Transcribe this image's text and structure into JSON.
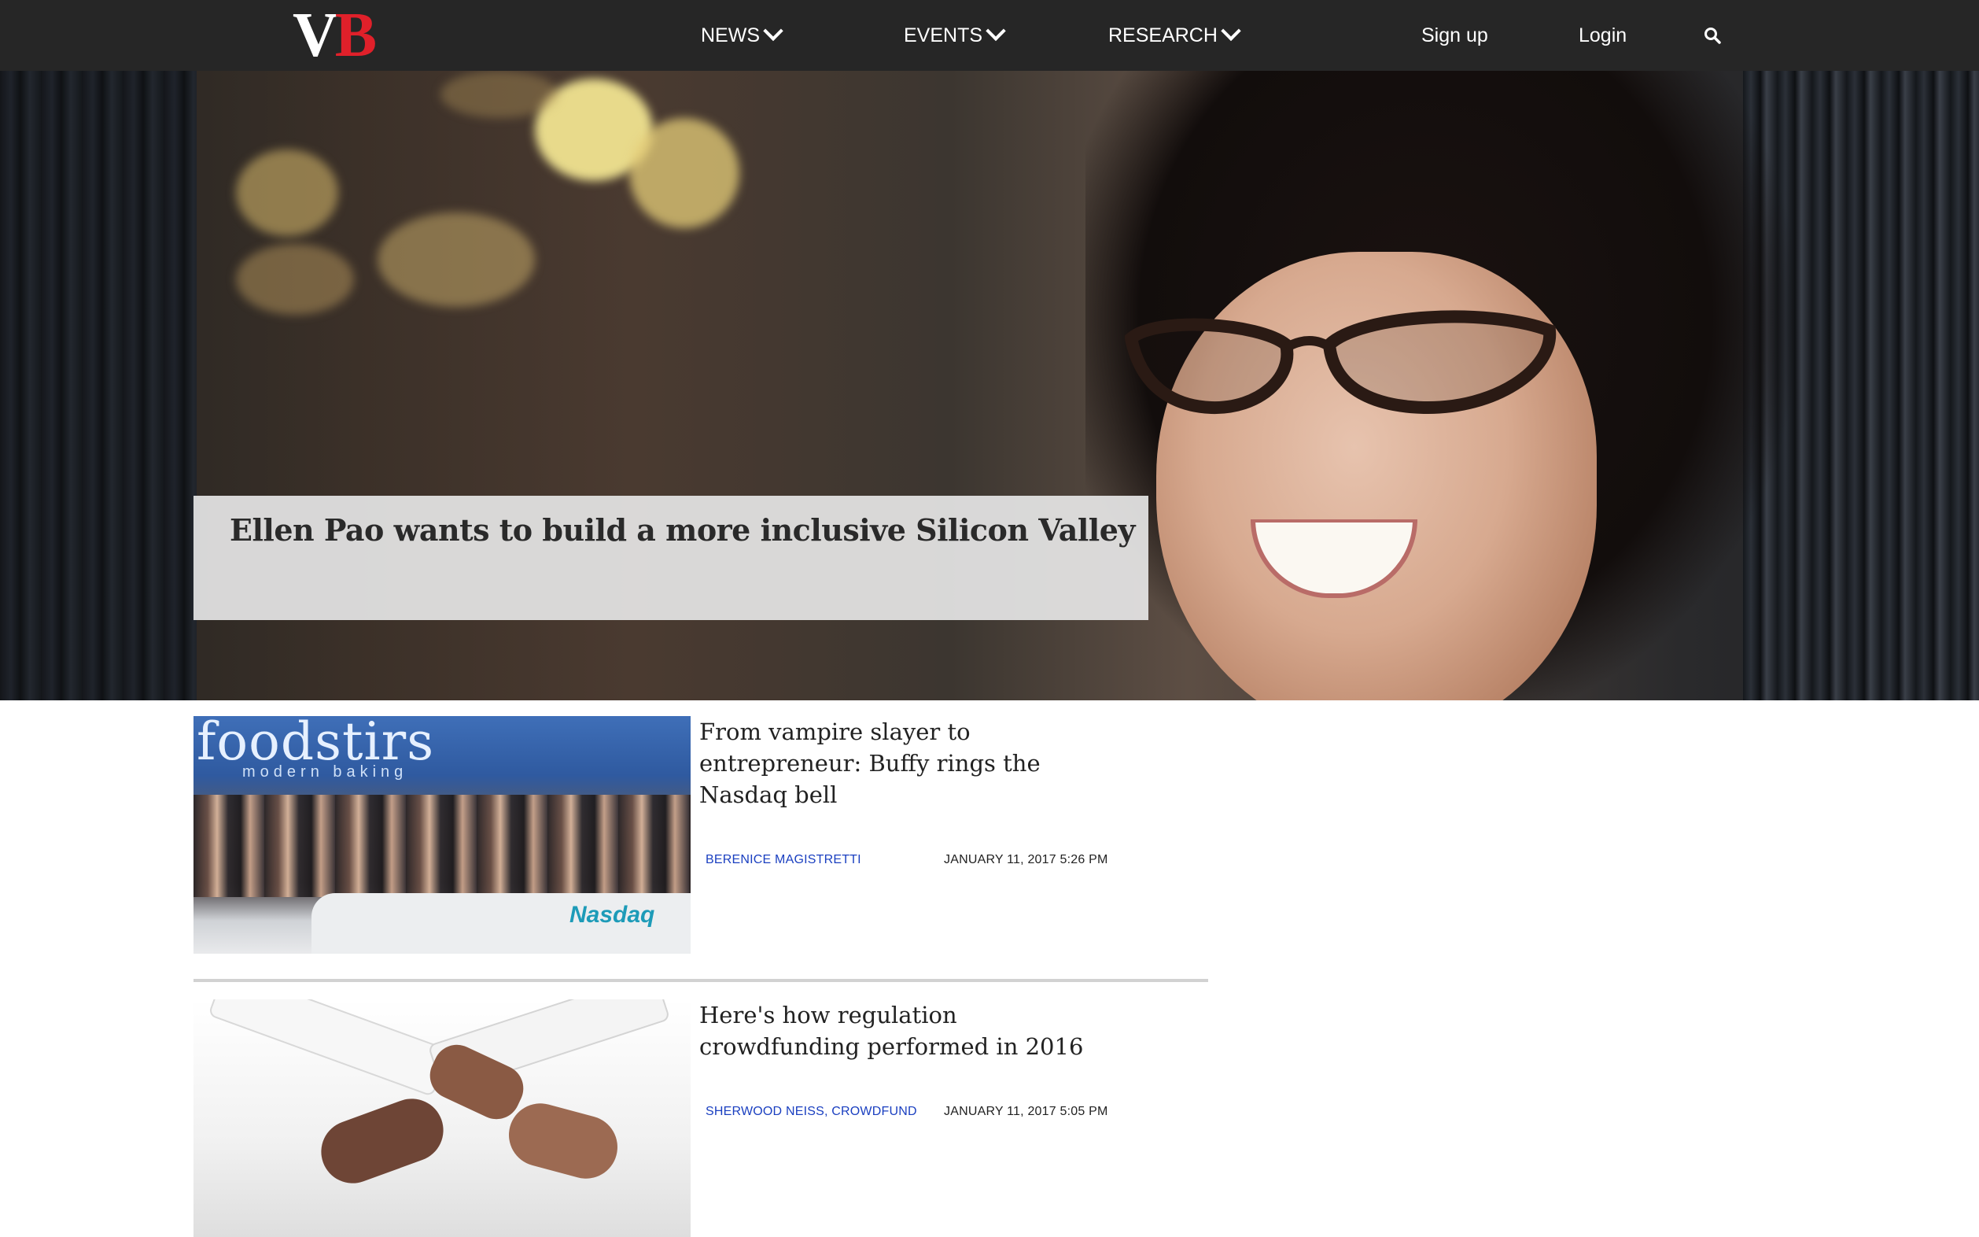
{
  "nav": {
    "logo_v": "V",
    "logo_b": "B",
    "items": [
      {
        "label": "NEWS"
      },
      {
        "label": "EVENTS"
      },
      {
        "label": "RESEARCH"
      }
    ],
    "signup_label": "Sign up",
    "login_label": "Login",
    "search_icon": "search-icon",
    "background_color": "#262626",
    "logo_accent_color": "#e0202a"
  },
  "hero": {
    "title": "Ellen Pao wants to build a more inclusive Silicon Valley"
  },
  "articles": [
    {
      "title": "From vampire slayer to entrepreneur: Buffy rings the Nasdaq bell",
      "author": "BERENICE MAGISTRETTI",
      "date": "JANUARY 11, 2017 5:26 PM",
      "thumb_brand": "foodstirs",
      "thumb_brand_sub": "modern baking",
      "thumb_podium_text": "Nasdaq"
    },
    {
      "title": "Here's how regulation crowdfunding performed in 2016",
      "author": "SHERWOOD NEISS, CROWDFUND",
      "date": "JANUARY 11, 2017 5:05 PM"
    }
  ],
  "colors": {
    "author_link": "#1a3fc0",
    "divider": "#d2d2d2"
  }
}
